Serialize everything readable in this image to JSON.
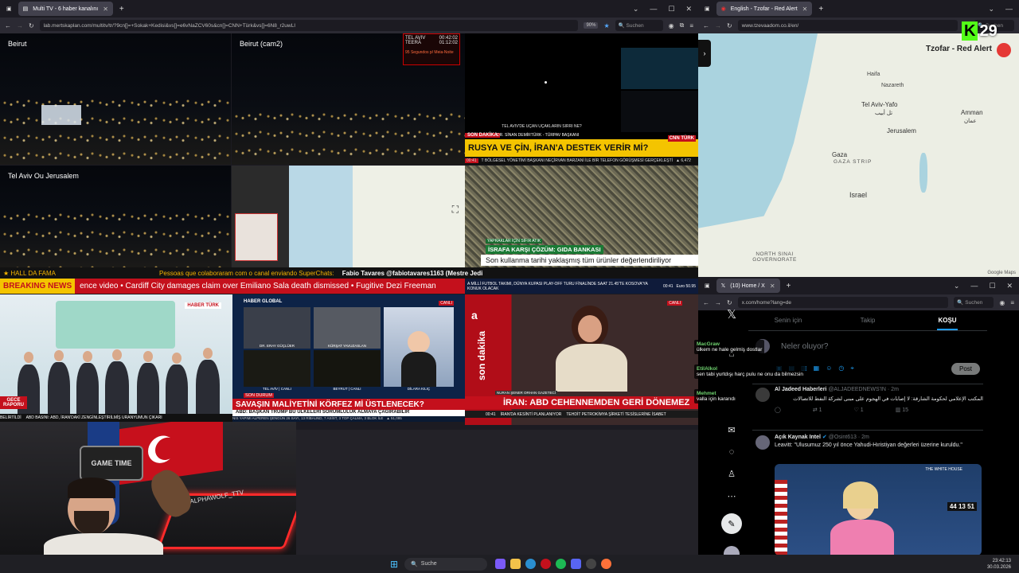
{
  "left_window": {
    "tab_title": "Multi TV - 6 haber kanalını",
    "url": "lab.mertskaplan.com/multitv/tr/?9cn[]=+Sokak+Kedisi&vs[]=e6vNaZCV60s&cn[]=CNN+Türk&vs[]=6N8_r2uwLI",
    "zoom": "90%",
    "search_placeholder": "Suchen"
  },
  "cams": {
    "beirut": "Beirut",
    "beirut_cam2": "Beirut (cam2)",
    "telaviv": "Tel Aviv Ou Jerusalem"
  },
  "siren_box": {
    "row1_city": "TEL AVIV",
    "row1_time": "00:42:02",
    "row2_city": "TEERÃ",
    "row2_time": "01:12:02",
    "footer": "95 Segundos p/ Meia-Noite"
  },
  "cnn_turk": {
    "caption_left": "TEL AVIV'DE UÇAN UÇAKLARIN SIRRI NE?",
    "son_dakika": "SON DAKİKA",
    "guest": "DR. SİNAN DEMİRTÜRK - TÜRPAV BAŞKANI",
    "headline": "RUSYA VE ÇİN, İRAN'A DESTEK VERİR Mİ?",
    "logo": "CNN TÜRK",
    "canli": "CANLI",
    "ticker_time": "00:41",
    "ticker": "T BÖLGESEL YÖNETİMİ BAŞKANI NEÇİRVAN BARZANİ İLE BİR TELEFON GÖRÜŞMESİ GERÇEKLEŞTİ",
    "index": "▲ 6,472"
  },
  "waste_channel": {
    "tag": "YAPRAKLAR İÇİN SIFIR ATIK",
    "title": "İSRAFA KARŞI ÇÖZÜM: GIDA BANKASI",
    "subtitle": "Son kullanma tarihi yaklaşmış tüm ürünler değerlendiriliyor",
    "ticker": "A MİLLİ FUTBOL TAKIMI, DÜNYA KUPASI PLAY-OFF TURU FİNALİNDE SAAT 21.45'TE KOSOVA'YA KONUK OLACAK",
    "time": "00:41",
    "euro": "Euro 50.95"
  },
  "middle_ticker": {
    "hall_label": "HALL DA FAMA",
    "superchat_text": "Pessoas que colaboraram com o canal enviando SuperChats:",
    "donor": "Fabio Tavares @fabiotavares1163 (Mestre Jedi"
  },
  "breaking": {
    "label": "BREAKING NEWS",
    "ticker": "ence video  •  Cardiff City damages claim over Emiliano Sala death dismissed  •  Fugitive Dezi Freeman"
  },
  "haber_turk": {
    "logo": "HABER TÜRK",
    "program": "GECE RAPORU",
    "ticker": "ABD BASINI: ABD, İRAN'DAKİ ZENGİNLEŞTİRİLMİŞ URANYUMUN ÇIKARI",
    "belirtildi": "BELİRTİLDİ"
  },
  "haber_global": {
    "logo": "HABER GLOBAL",
    "canli": "CANLI",
    "guest1": "DR. ERAY GÜÇLÜER",
    "guest1_role": "ALTINBAŞ ÜNİVERSİTESİ ÖĞRETİM ÜYESİ",
    "guest2": "KÜRŞAT YAVUZASLAN",
    "guest2_role": "GAZETECİ",
    "city_label": "TEL AVİV | CANLI",
    "city_label2": "BEYRUT | CANLI",
    "anchor": "DİLARA KILIÇ",
    "son_durum": "SON DURUM",
    "headline": "SAVAŞIN MALİYETİNİ KÖRFEZ Mİ ÜSTLENECEK?",
    "sub": "ABD: BAŞKAN TRUMP BU ÜLKELERİ SORUMLULUK ALMAYA ÇAĞIRABİLİR",
    "ticker": "NIS YAPIMI ALPEREN ŞENGÜN 26 SAYI, 13 RİBAUND, 7 ASİST, 3 TOP ÇALMA, 3 BLOK İLE",
    "index": "▲ 51,095"
  },
  "a_haber": {
    "logo": "son dakika",
    "canli": "CANLI",
    "guest": "NURAN ŞENER ORHAN GAZETECİ",
    "headline": "İRAN: ABD CEHENNEMDEN GERİ DÖNEMEZ",
    "sub": "İRAN'DA KESİNTİ PLANLANIYOR",
    "ticker": "TEHDİT PETROKİMYA ŞİRKETİ TESİSLERİNE İSABET",
    "time": "00:41"
  },
  "tzofar_window": {
    "tab_title": "English - Tzofar - Red Alert",
    "url": "www.tzevaadom.co.il/en/",
    "search_placeholder": "Suchen",
    "site_title": "Tzofar - Red Alert",
    "map_labels": {
      "haifa": "Haifa",
      "nazareth": "Nazareth",
      "telaviv": "Tel Aviv-Yafo",
      "telaviv_ar": "تل أبيب",
      "amman": "Amman",
      "amman_ar": "عمان",
      "jerusalem": "Jerusalem",
      "gaza": "Gaza",
      "gaza_strip": "GAZA STRIP",
      "israel": "Israel",
      "north_sinai": "NORTH SINAI GOVERNORATE",
      "google": "Google Maps"
    }
  },
  "overlay_badge": {
    "letter": "K",
    "number": "29"
  },
  "x_window": {
    "tab_title": "(10) Home / X",
    "url": "x.com/home?lang=de",
    "search_placeholder": "Suchen",
    "tabs": [
      "Senin için",
      "Takip",
      "KOŞU"
    ],
    "compose_placeholder": "Neler oluyor?",
    "post_button": "Post",
    "tweet1": {
      "author": "Al Jadeed Haberleri",
      "handle": "@ALJADEEDNEWS'IN · 2m",
      "text": "المكتب الإعلامي لحكومة الشارقة: لا إصابات في الهجوم على مبنى لشركة النفط للاتصالات",
      "replies": "",
      "retweets": "1",
      "likes": "1",
      "views": "15"
    },
    "tweet2": {
      "author": "Açık Kaynak Intel",
      "handle": "@Osint613 · 2m",
      "text": "Leavitt: \"Ulusumuz 250 yıl önce Yahudi-Hıristiyan değerleri üzerine kuruldu.\"",
      "video_tag": "THE WHITE HOUSE",
      "clock": "44 13 51"
    }
  },
  "chat_overlay": [
    {
      "user": "MacGraw",
      "msg": "ülkem ne hale gelmiş dostlar"
    },
    {
      "user": "EtilAlkol",
      "msg": "sen tabi yurtdışı harç pulu ne onu da bilmezsin"
    },
    {
      "user": "Mehmet",
      "msg": "valla için kararıdı"
    }
  ],
  "streamer": {
    "webcam_text": "ALPHAWOLF_TTV",
    "game_logo": "GAME TIME"
  },
  "taskbar": {
    "search_label": "Suche",
    "time": "23:42:13",
    "date": "30.03.2026"
  },
  "colors": {
    "red": "#c4101c",
    "cnn_yellow": "#f4c400",
    "x_blue": "#1d9bf0"
  }
}
